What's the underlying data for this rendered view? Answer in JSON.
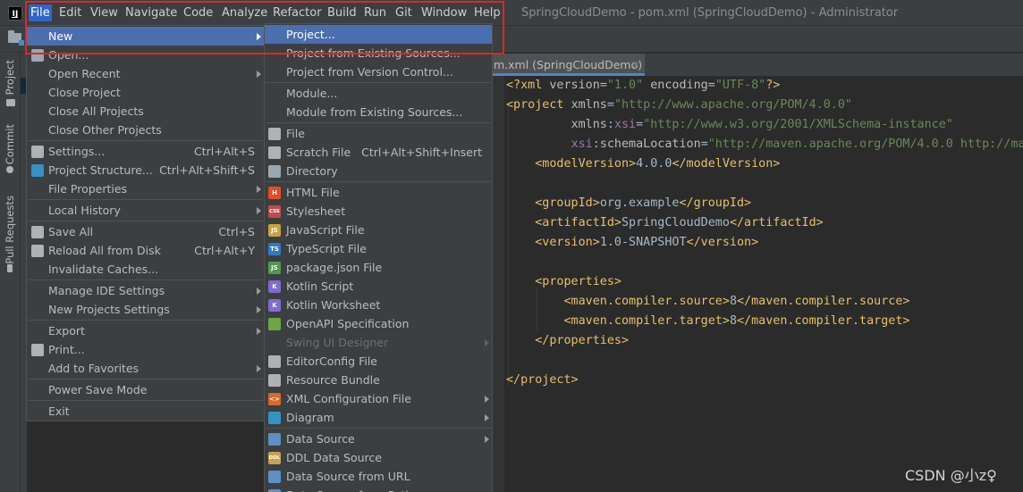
{
  "menubar": {
    "items": [
      "File",
      "Edit",
      "View",
      "Navigate",
      "Code",
      "Analyze",
      "Refactor",
      "Build",
      "Run",
      "Git",
      "Window",
      "Help"
    ],
    "active": "File",
    "window_title": "SpringCloudDemo - pom.xml (SpringCloudDemo) - Administrator"
  },
  "left_strip": {
    "tabs": [
      "Project",
      "Commit",
      "Pull Requests"
    ]
  },
  "editor": {
    "tab_label": "m.xml (SpringCloudDemo)",
    "close_glyph": "×",
    "lines": [
      [
        [
          "tag",
          "<?xml "
        ],
        [
          "attr",
          "version"
        ],
        [
          "txt",
          "="
        ],
        [
          "val",
          "\"1.0\""
        ],
        [
          "txt",
          " "
        ],
        [
          "attr",
          "encoding"
        ],
        [
          "txt",
          "="
        ],
        [
          "val",
          "\"UTF-8\""
        ],
        [
          "tag",
          "?>"
        ]
      ],
      [
        [
          "tag",
          "<project "
        ],
        [
          "attr",
          "xmlns"
        ],
        [
          "txt",
          "="
        ],
        [
          "val",
          "\"http://www.apache.org/POM/4.0.0\""
        ]
      ],
      [
        [
          "txt",
          "         "
        ],
        [
          "attr",
          "xmlns"
        ],
        [
          "txt",
          ":"
        ],
        [
          "ns",
          "xsi"
        ],
        [
          "txt",
          "="
        ],
        [
          "val",
          "\"http://www.w3.org/2001/XMLSchema-instance\""
        ]
      ],
      [
        [
          "txt",
          "         "
        ],
        [
          "ns",
          "xsi"
        ],
        [
          "txt",
          ":"
        ],
        [
          "attr",
          "schemaLocation"
        ],
        [
          "txt",
          "="
        ],
        [
          "val",
          "\"http://maven.apache.org/POM/4.0.0 http://ma"
        ]
      ],
      [
        [
          "txt",
          "    "
        ],
        [
          "tag",
          "<modelVersion>"
        ],
        [
          "txt",
          "4.0.0"
        ],
        [
          "tag",
          "</modelVersion>"
        ]
      ],
      [],
      [
        [
          "txt",
          "    "
        ],
        [
          "tag",
          "<groupId>"
        ],
        [
          "txt",
          "org.example"
        ],
        [
          "tag",
          "</groupId>"
        ]
      ],
      [
        [
          "txt",
          "    "
        ],
        [
          "tag",
          "<artifactId>"
        ],
        [
          "txt",
          "SpringCloudDemo"
        ],
        [
          "tag",
          "</artifactId>"
        ]
      ],
      [
        [
          "txt",
          "    "
        ],
        [
          "tag",
          "<version>"
        ],
        [
          "txt",
          "1.0-SNAPSHOT"
        ],
        [
          "tag",
          "</version>"
        ]
      ],
      [],
      [
        [
          "txt",
          "    "
        ],
        [
          "tag",
          "<properties>"
        ]
      ],
      [
        [
          "txt",
          "        "
        ],
        [
          "tag",
          "<maven.compiler.source>"
        ],
        [
          "txt",
          "8"
        ],
        [
          "tag",
          "</maven.compiler.source>"
        ]
      ],
      [
        [
          "txt",
          "        "
        ],
        [
          "tag",
          "<maven.compiler.target>"
        ],
        [
          "txt",
          "8"
        ],
        [
          "tag",
          "</maven.compiler.target>"
        ]
      ],
      [
        [
          "txt",
          "    "
        ],
        [
          "tag",
          "</properties>"
        ]
      ],
      [],
      [
        [
          "tag",
          "</project>"
        ]
      ]
    ]
  },
  "file_menu": [
    {
      "label": "New",
      "arrow": true,
      "selected": true
    },
    {
      "label": "Open...",
      "icon": "folder-icon"
    },
    {
      "label": "Open Recent",
      "arrow": true
    },
    {
      "label": "Close Project"
    },
    {
      "label": "Close All Projects"
    },
    {
      "label": "Close Other Projects"
    },
    {
      "sep": true
    },
    {
      "label": "Settings...",
      "shortcut": "Ctrl+Alt+S",
      "icon": "wrench-icon"
    },
    {
      "label": "Project Structure...",
      "shortcut": "Ctrl+Alt+Shift+S",
      "icon": "project-structure-icon"
    },
    {
      "label": "File Properties",
      "arrow": true
    },
    {
      "sep": true
    },
    {
      "label": "Local History",
      "arrow": true
    },
    {
      "sep": true
    },
    {
      "label": "Save All",
      "shortcut": "Ctrl+S",
      "icon": "save-icon"
    },
    {
      "label": "Reload All from Disk",
      "shortcut": "Ctrl+Alt+Y",
      "icon": "reload-icon"
    },
    {
      "label": "Invalidate Caches..."
    },
    {
      "sep": true
    },
    {
      "label": "Manage IDE Settings",
      "arrow": true
    },
    {
      "label": "New Projects Settings",
      "arrow": true
    },
    {
      "sep": true
    },
    {
      "label": "Export",
      "arrow": true
    },
    {
      "label": "Print...",
      "icon": "print-icon"
    },
    {
      "label": "Add to Favorites",
      "arrow": true
    },
    {
      "sep": true
    },
    {
      "label": "Power Save Mode"
    },
    {
      "sep": true
    },
    {
      "label": "Exit"
    }
  ],
  "new_menu": [
    {
      "label": "Project...",
      "selected": true
    },
    {
      "label": "Project from Existing Sources..."
    },
    {
      "label": "Project from Version Control..."
    },
    {
      "sep": true
    },
    {
      "label": "Module..."
    },
    {
      "label": "Module from Existing Sources..."
    },
    {
      "sep": true
    },
    {
      "label": "File",
      "icon": "file-icon"
    },
    {
      "label": "Scratch File",
      "shortcut": "Ctrl+Alt+Shift+Insert",
      "icon": "scratch-file-icon"
    },
    {
      "label": "Directory",
      "icon": "directory-icon"
    },
    {
      "sep": true
    },
    {
      "label": "HTML File",
      "icon": "html-icon"
    },
    {
      "label": "Stylesheet",
      "icon": "css-icon"
    },
    {
      "label": "JavaScript File",
      "icon": "js-icon"
    },
    {
      "label": "TypeScript File",
      "icon": "ts-icon"
    },
    {
      "label": "package.json File",
      "icon": "nodejs-icon"
    },
    {
      "label": "Kotlin Script",
      "icon": "kotlin-icon"
    },
    {
      "label": "Kotlin Worksheet",
      "icon": "kotlin-worksheet-icon"
    },
    {
      "label": "OpenAPI Specification",
      "icon": "openapi-icon"
    },
    {
      "label": "Swing UI Designer",
      "arrow": true,
      "disabled": true
    },
    {
      "label": "EditorConfig File",
      "icon": "editorconfig-icon"
    },
    {
      "label": "Resource Bundle",
      "icon": "resource-bundle-icon"
    },
    {
      "label": "XML Configuration File",
      "arrow": true,
      "icon": "xml-icon"
    },
    {
      "label": "Diagram",
      "arrow": true,
      "icon": "diagram-icon"
    },
    {
      "sep": true
    },
    {
      "label": "Data Source",
      "arrow": true,
      "icon": "data-source-icon"
    },
    {
      "label": "DDL Data Source",
      "icon": "ddl-icon"
    },
    {
      "label": "Data Source from URL",
      "icon": "data-source-url-icon"
    },
    {
      "label": "Data Source from Path",
      "icon": "data-source-path-icon"
    }
  ],
  "icon_glyphs": {
    "html-icon": "H",
    "css-icon": "CSS",
    "js-icon": "JS",
    "ts-icon": "TS",
    "nodejs-icon": "JS",
    "kotlin-icon": "K",
    "kotlin-worksheet-icon": "K",
    "ddl-icon": "DDL",
    "xml-icon": "<>",
    "openapi-icon": ""
  },
  "icon_colors": {
    "folder-icon": "#9aa7b0",
    "wrench-icon": "#afb1b3",
    "project-structure-icon": "#3592c4",
    "save-icon": "#afb1b3",
    "reload-icon": "#afb1b3",
    "print-icon": "#afb1b3",
    "file-icon": "#afb1b3",
    "scratch-file-icon": "#afb1b3",
    "directory-icon": "#9aa7b0",
    "html-icon": "#e44d26",
    "css-icon": "#c14b4b",
    "js-icon": "#c7a33a",
    "ts-icon": "#3178c6",
    "nodejs-icon": "#4d9c4d",
    "kotlin-icon": "#7f6bd1",
    "kotlin-worksheet-icon": "#7f6bd1",
    "openapi-icon": "#6fa44a",
    "editorconfig-icon": "#afb1b3",
    "resource-bundle-icon": "#afb1b3",
    "xml-icon": "#d8682d",
    "diagram-icon": "#3592c4",
    "data-source-icon": "#5f8fc4",
    "ddl-icon": "#c9a14a",
    "data-source-url-icon": "#5f8fc4",
    "data-source-path-icon": "#5f8fc4"
  },
  "watermark": "CSDN @小z♀"
}
